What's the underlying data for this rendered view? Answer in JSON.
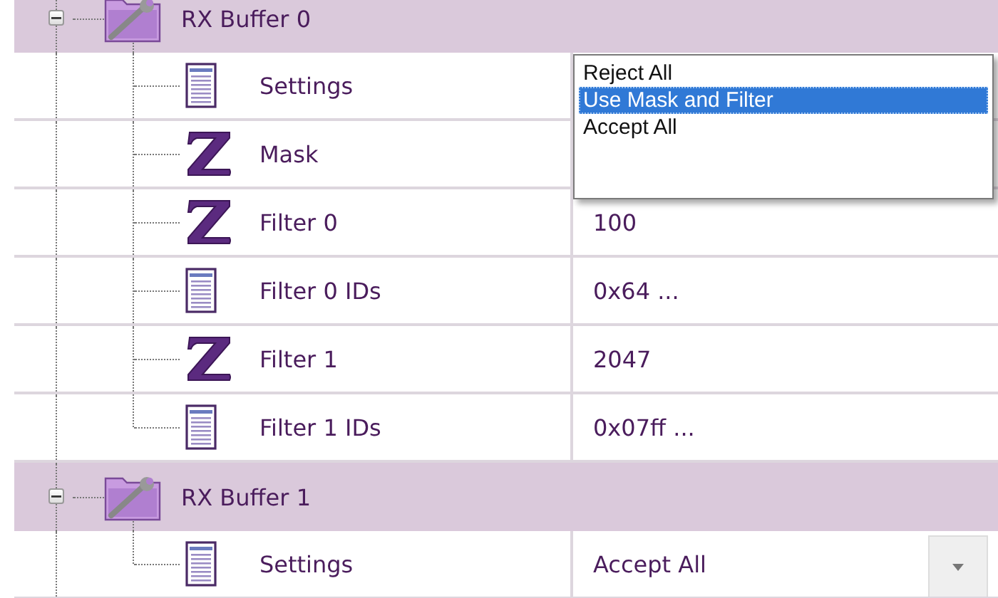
{
  "groups": [
    {
      "label": "RX Buffer 0",
      "expanded": true,
      "children": [
        {
          "kind": "list",
          "label": "Settings",
          "editing": false
        },
        {
          "kind": "number",
          "label": "Mask",
          "editing": false
        },
        {
          "kind": "number",
          "label": "Filter 0",
          "value": "100",
          "editing": false
        },
        {
          "kind": "list",
          "label": "Filter 0 IDs",
          "value": "0x64 ...",
          "editing": false
        },
        {
          "kind": "number",
          "label": "Filter 1",
          "value": "2047",
          "editing": false
        },
        {
          "kind": "list",
          "label": "Filter 1 IDs",
          "value": "0x07ff ...",
          "editing": false
        }
      ]
    },
    {
      "label": "RX Buffer 1",
      "expanded": true,
      "children": [
        {
          "kind": "list",
          "label": "Settings",
          "value": "Accept All",
          "editing": true
        }
      ]
    }
  ],
  "dropdown": {
    "options": [
      {
        "label": "Reject All",
        "selected": false
      },
      {
        "label": "Use Mask and Filter",
        "selected": true
      },
      {
        "label": "Accept All",
        "selected": false
      }
    ]
  }
}
